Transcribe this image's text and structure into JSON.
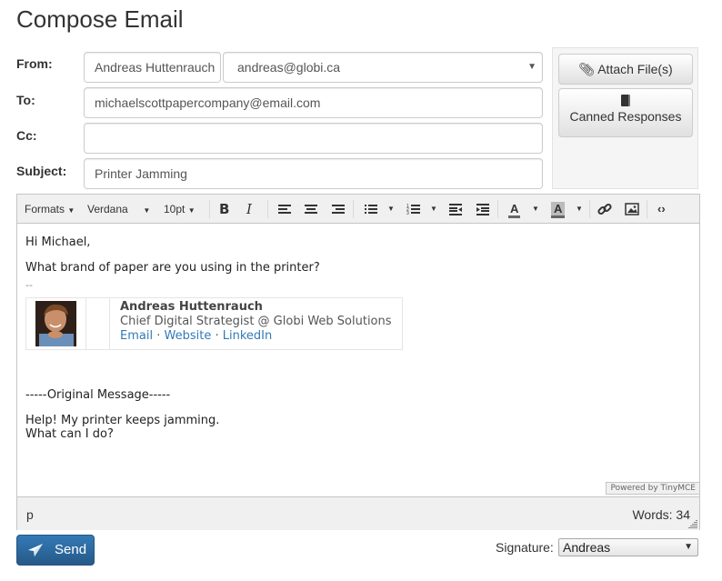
{
  "page": {
    "title": "Compose Email"
  },
  "form": {
    "from_label": "From:",
    "from_name": "Andreas Huttenrauch",
    "from_email_selected": "andreas@globi.ca",
    "to_label": "To:",
    "to_value": "michaelscottpapercompany@email.com",
    "cc_label": "Cc:",
    "cc_value": "",
    "subject_label": "Subject:",
    "subject_value": "Printer Jamming"
  },
  "side": {
    "attach_label": "Attach File(s)",
    "canned_label": "Canned Responses"
  },
  "toolbar": {
    "formats": "Formats",
    "font": "Verdana",
    "size": "10pt",
    "buttons": [
      "bold",
      "italic",
      "align-left",
      "align-center",
      "align-right",
      "bullet-list",
      "numbered-list",
      "outdent",
      "indent",
      "text-color",
      "background-color",
      "link",
      "image",
      "source-code"
    ]
  },
  "content": {
    "greeting": "Hi Michael,",
    "body": "What brand of paper are you using in the printer?",
    "sig_separator": "--",
    "signature": {
      "name": "Andreas Huttenrauch",
      "role": "Chief Digital Strategist @ Globi Web Solutions",
      "links": [
        "Email",
        "Website",
        "LinkedIn"
      ],
      "separator": "·"
    },
    "original_header": "-----Original Message-----",
    "original_line1": "Help! My printer keeps jamming.",
    "original_line2": "What can I do?"
  },
  "editor": {
    "powered_by": "Powered by TinyMCE",
    "path": "p",
    "word_count": "Words: 34"
  },
  "footer": {
    "send_label": "Send",
    "signature_label": "Signature:",
    "signature_selected": "Andreas"
  },
  "colors": {
    "primary": "#337ab7",
    "link": "#337ab7"
  }
}
